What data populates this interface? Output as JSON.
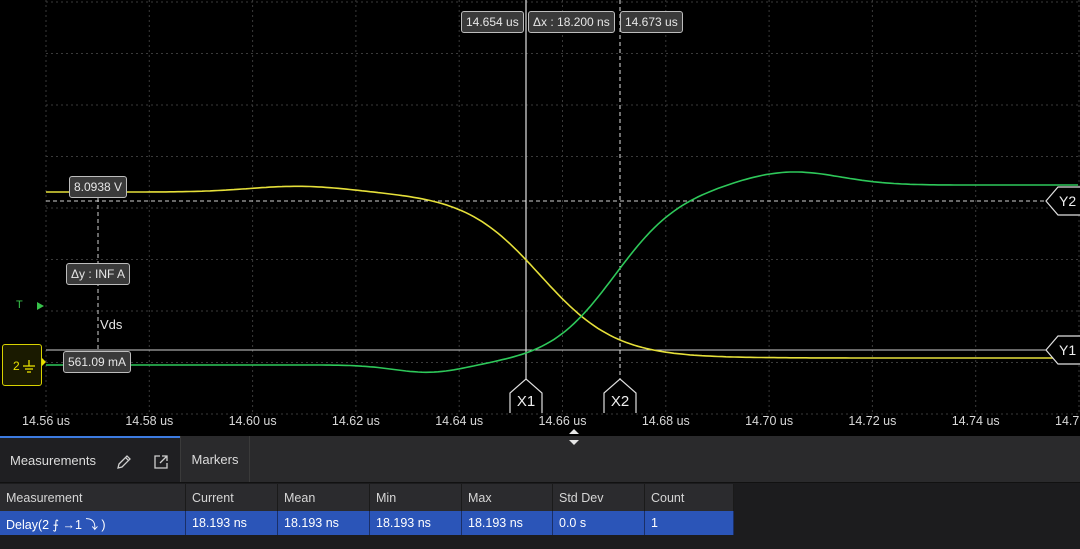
{
  "scope": {
    "time_axis": {
      "min": 14.56,
      "max": 14.75,
      "unit": "us",
      "tick_labels": [
        "14.56 us",
        "14.58 us",
        "14.60 us",
        "14.62 us",
        "14.64 us",
        "14.66 us",
        "14.68 us",
        "14.70 us",
        "14.72 us",
        "14.74 us",
        "14.7"
      ]
    },
    "cursors": {
      "x1_readout": "14.654 us",
      "x2_readout": "14.673 us",
      "delta_x": "Δx : 18.200 ns",
      "x1_label": "X1",
      "x2_label": "X2",
      "y1_readout": "561.09 mA",
      "y2_readout": "8.0938 V",
      "delta_y": "Δy : INF A",
      "y1_label": "Y1",
      "y2_label": "Y2"
    },
    "trigger_label": "T",
    "channel_label": "Vds",
    "channel_number": "2",
    "colors": {
      "vds_trace": "#e6e03a",
      "current_trace": "#2ec85a",
      "grid": "#3a3a3a",
      "accent": "#3c7be0"
    }
  },
  "panel": {
    "tabs": {
      "measurements": "Measurements",
      "markers": "Markers"
    },
    "table": {
      "headers": [
        "Measurement",
        "Current",
        "Mean",
        "Min",
        "Max",
        "Std Dev",
        "Count"
      ],
      "rows": [
        {
          "measurement": "Delay(2 ⨍ →1 ⤵ )",
          "current": "18.193 ns",
          "mean": "18.193 ns",
          "min": "18.193 ns",
          "max": "18.193 ns",
          "std_dev": "0.0 s",
          "count": "1"
        }
      ]
    }
  }
}
